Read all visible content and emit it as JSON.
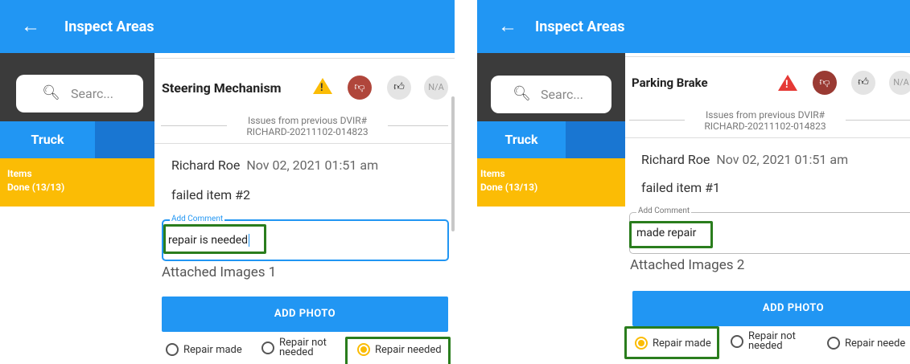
{
  "screens": [
    {
      "app_title": "Inspect Areas",
      "back_icon": "arrow-left-icon",
      "search_placeholder": "Searc...",
      "tab_truck": "Truck",
      "items_label": "Items",
      "items_done": "Done (13/13)",
      "item_title": "Steering Mechanism",
      "issues_title": "Issues from previous DVIR#",
      "issues_id": "RICHARD-20211102-014823",
      "author": "Richard Roe",
      "date": "Nov 02, 2021  01:51 am",
      "failed_text": "failed item #2",
      "comment_label": "Add Comment",
      "comment_value": "repair is needed",
      "attached_images": "Attached Images 1",
      "add_photo": "ADD PHOTO",
      "na_label": "N/A",
      "radio_repair_made": "Repair made",
      "radio_repair_not_line1": "Repair not",
      "radio_repair_not_line2": "needed",
      "radio_repair_needed": "Repair needed",
      "selected_option": "Repair needed"
    },
    {
      "app_title": "Inspect Areas",
      "back_icon": "arrow-left-icon",
      "search_placeholder": "Searc...",
      "tab_truck": "Truck",
      "items_label": "Items",
      "items_done": "Done (13/13)",
      "item_title": "Parking Brake",
      "issues_title": "Issues from previous DVIR#",
      "issues_id": "RICHARD-20211102-014823",
      "author": "Richard Roe",
      "date": "Nov 02, 2021  01:51 am",
      "failed_text": "failed item #1",
      "comment_label": "Add Comment",
      "comment_value": "made repair",
      "attached_images": "Attached Images 2",
      "add_photo": "ADD PHOTO",
      "na_label": "N/A",
      "radio_repair_made": "Repair made",
      "radio_repair_not_line1": "Repair not",
      "radio_repair_not_line2": "needed",
      "radio_repair_needed": "Repair neede",
      "selected_option": "Repair made"
    }
  ],
  "colors": {
    "appbar": "#2196f3",
    "sidebar_dark": "#3b3b3b",
    "items_yellow": "#fbbc05",
    "highlight_green": "#2a7d1d",
    "warning_yellow": "#fbbc05",
    "warning_red": "#e53935",
    "thumb_down_left": "#b0463b",
    "thumb_down_right": "#9a3a33"
  }
}
